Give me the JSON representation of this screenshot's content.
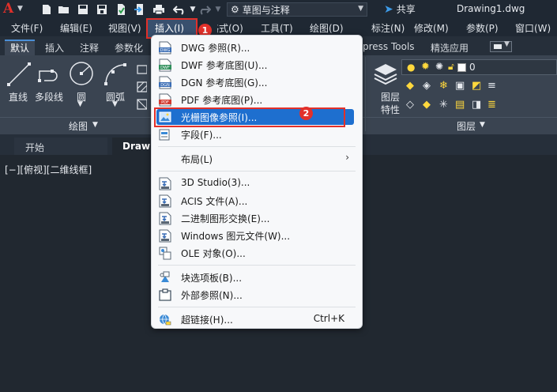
{
  "titlebar": {
    "app_logo": "A",
    "workspace": "草图与注释",
    "share": "共享",
    "document": "Drawing1.dwg",
    "icons": [
      "new-icon",
      "open-icon",
      "save-icon",
      "save-as-icon",
      "import-icon",
      "export-icon",
      "print-icon",
      "undo-icon",
      "redo-icon",
      "gear-icon",
      "share-icon"
    ]
  },
  "menubar": {
    "items": [
      "文件(F)",
      "编辑(E)",
      "视图(V)",
      "插入(I)",
      "格式(O)",
      "工具(T)",
      "绘图(D)",
      "标注(N)",
      "修改(M)",
      "参数(P)",
      "窗口(W)"
    ],
    "insert_visible": "插入(I)",
    "format_partial": "格式(O)"
  },
  "ribbon_tabs": [
    "默认",
    "插入",
    "注释",
    "参数化",
    "press Tools",
    "精选应用"
  ],
  "ribbon": {
    "draw_tools": [
      "直线",
      "多段线",
      "圆",
      "圆弧"
    ],
    "draw_panel": "绘图",
    "layer_tools": [
      "图层",
      "特性"
    ],
    "layer_panel": "图层",
    "layer_value": "0"
  },
  "filetabs": {
    "start": "开始",
    "drawing": "Drawi"
  },
  "viewport": {
    "label": "[−][俯视][二维线框]"
  },
  "insert_menu": {
    "items": [
      {
        "label": "DWG 参照(R)...",
        "icon": "dwg-icon"
      },
      {
        "label": "DWF 参考底图(U)...",
        "icon": "dwf-icon"
      },
      {
        "label": "DGN 参考底图(G)...",
        "icon": "dgn-icon"
      },
      {
        "label": "PDF 参考底图(P)...",
        "icon": "pdf-icon"
      },
      {
        "label": "光栅图像参照(I)...",
        "icon": "raster-image-icon"
      },
      {
        "label": "字段(F)...",
        "icon": "field-icon"
      },
      {
        "label": "布局(L)",
        "icon": "",
        "submenu": "›"
      },
      {
        "label": "3D Studio(3)...",
        "icon": "3ds-icon"
      },
      {
        "label": "ACIS 文件(A)...",
        "icon": "acis-icon"
      },
      {
        "label": "二进制图形交换(E)...",
        "icon": "dxb-icon"
      },
      {
        "label": "Windows 图元文件(W)...",
        "icon": "wmf-icon"
      },
      {
        "label": "OLE 对象(O)...",
        "icon": "ole-icon"
      },
      {
        "label": "块选项板(B)...",
        "icon": "block-palette-icon"
      },
      {
        "label": "外部参照(N)...",
        "icon": "xref-icon"
      },
      {
        "label": "超链接(H)...",
        "icon": "hyperlink-icon",
        "shortcut": "Ctrl+K"
      }
    ],
    "selected_index": 4
  },
  "annotations": {
    "badge1": "1",
    "badge2": "2"
  },
  "colors": {
    "accent_red": "#e2302a",
    "highlight_blue": "#1e6fcf",
    "background": "#212830"
  }
}
